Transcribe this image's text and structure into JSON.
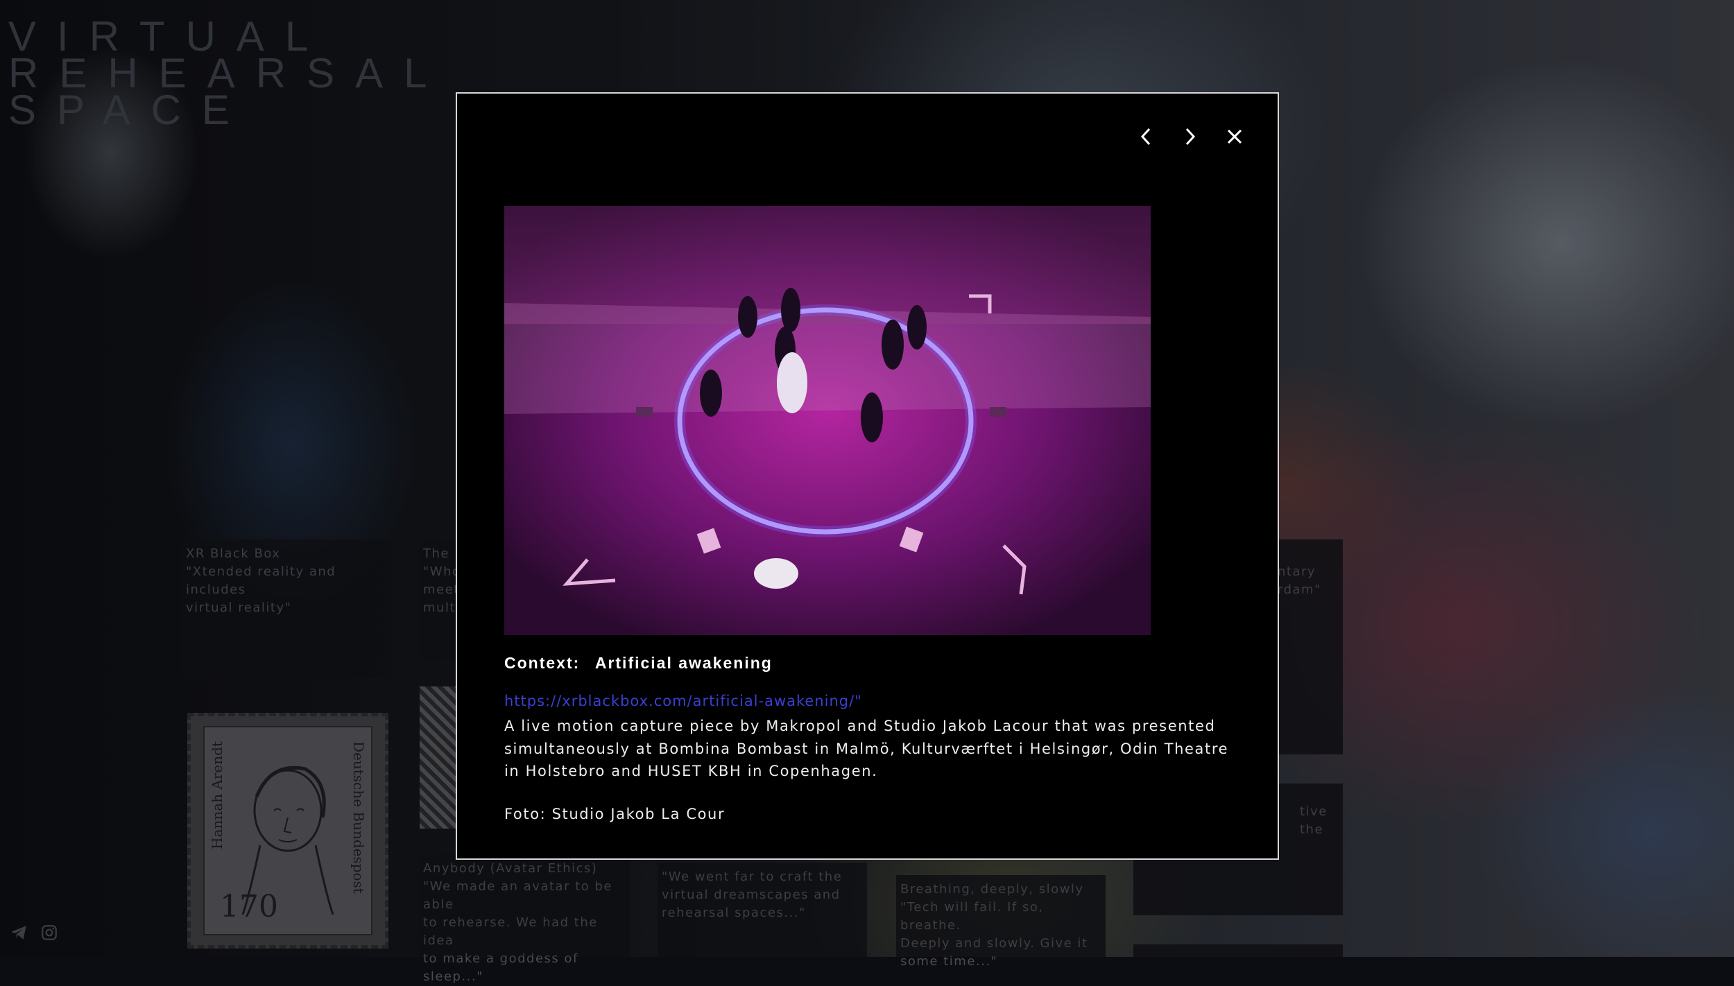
{
  "site": {
    "logo": "VIRTUAL\nREHEARSAL\nSPACE",
    "corner_text": "bombina\nbombast"
  },
  "cards": [
    {
      "title": "XR Black Box",
      "quote": "\"Xtended reality and includes\nvirtual reality\""
    },
    {
      "title": "The",
      "quote": "\"Who\nmeet\nmult"
    },
    {
      "title": "",
      "quote": "ntary\nrdam\""
    },
    {
      "title": "Anybody (Avatar Ethics)",
      "quote": "\"We made an avatar to be able\nto rehearse. We had the idea\nto make a goddess of sleep...\""
    },
    {
      "title": "",
      "quote": "\"We went far to craft the\nvirtual dreamscapes and\nrehearsal spaces...\""
    },
    {
      "title": "Breathing, deeply, slowly",
      "quote": "\"Tech will fail. If so, breathe.\nDeeply and slowly. Give it\nsome time...\""
    },
    {
      "title": "",
      "quote": "tive\nthe"
    }
  ],
  "stamp": {
    "name": "Hannah Arendt",
    "country": "Deutsche Bundespost",
    "value": "170"
  },
  "modal": {
    "context_label": "Context:",
    "context_value": "Artificial awakening",
    "link": "https://xrblackbox.com/artificial-awakening/\"",
    "description": "A live motion capture piece by Makropol and Studio Jakob Lacour that was presented simultaneously at Bombina Bombast in Malmö, Kulturværftet i Helsingør, Odin Theatre in Holstebro and HUSET KBH in Copenhagen.",
    "credit": "Foto: Studio Jakob La Cour"
  },
  "icons": {
    "prev": "chevron-left-icon",
    "next": "chevron-right-icon",
    "close": "close-icon",
    "telegram": "telegram-icon",
    "instagram": "instagram-icon"
  }
}
